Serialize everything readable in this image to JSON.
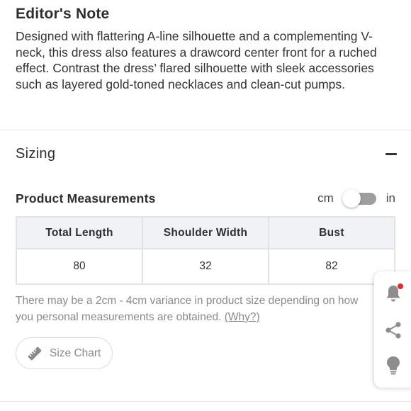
{
  "editors_note": {
    "title": "Editor's Note",
    "body": "Designed with flattering A-line silhouette and a complementing V-neck, this dress also features a drawcord center front for a ruched effect. Contrast the dress’ flared silhouette with sleek accessories such as layered gold-toned necklaces and clean-cut pumps."
  },
  "sizing": {
    "title": "Sizing",
    "collapse_icon": "minus-icon",
    "product_measurements": {
      "title": "Product Measurements",
      "unit_left": "cm",
      "unit_right": "in",
      "selected_unit": "cm"
    },
    "table": {
      "headers": [
        "Total Length",
        "Shoulder Width",
        "Bust"
      ],
      "rows": [
        [
          "80",
          "32",
          "82"
        ]
      ]
    },
    "variance_text": "There may be a 2cm - 4cm variance in product size depending on how you personal measurements are obtained. ",
    "why_link": "(Why?)",
    "size_chart_button": "Size Chart",
    "size_chart_icon": "ruler-icon"
  },
  "floating_actions": {
    "icons": [
      "bell-icon",
      "share-icon",
      "lightbulb-icon"
    ],
    "notification_dot_color": "#e62a2a"
  }
}
